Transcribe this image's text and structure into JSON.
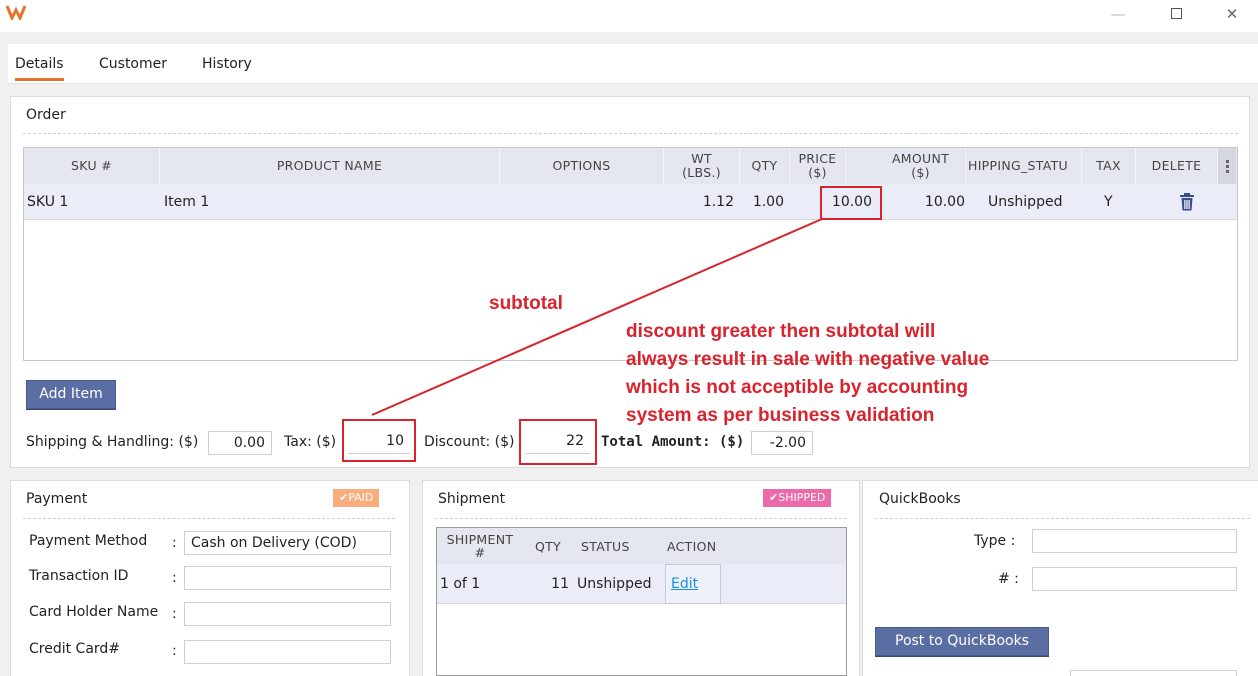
{
  "window": {
    "logo_icon": "app-logo-icon",
    "min_glyph": "—",
    "close_glyph": "✕"
  },
  "tabs": [
    {
      "label": "Details",
      "active": true
    },
    {
      "label": "Customer",
      "active": false
    },
    {
      "label": "History",
      "active": false
    }
  ],
  "order": {
    "title": "Order",
    "columns": [
      "SKU #",
      "PRODUCT NAME",
      "OPTIONS",
      "WT\n(LBS.)",
      "QTY",
      "PRICE\n($)",
      "AMOUNT\n($)",
      "HIPPING_STATU",
      "TAX",
      "DELETE"
    ],
    "rows": [
      {
        "sku": "SKU 1",
        "product": "Item 1",
        "options": "",
        "wt": "1.12",
        "qty": "1.00",
        "price": "10.00",
        "amount": "10.00",
        "shipping_status": "Unshipped",
        "tax": "Y",
        "delete_icon": "trash-icon"
      }
    ],
    "add_item_label": "Add Item",
    "shipping_label": "Shipping & Handling: ($)",
    "shipping_value": "0.00",
    "tax_label": "Tax: ($)",
    "tax_value": "10",
    "discount_label": "Discount: ($)",
    "discount_value": "22",
    "total_label": "Total Amount: ($)",
    "total_value": "-2.00"
  },
  "annotations": {
    "subtotal": "subtotal",
    "note_lines": [
      "discount greater then subtotal will",
      "always result in sale with negative value",
      "which is not acceptible by accounting",
      "system as per business validation"
    ],
    "color": "#d9232d"
  },
  "payment": {
    "title": "Payment",
    "badge": "PAID",
    "badge_color": "#f9ad7c",
    "fields": [
      {
        "label": "Payment Method",
        "value": "Cash on Delivery (COD)"
      },
      {
        "label": "Transaction ID",
        "value": ""
      },
      {
        "label": "Card Holder Name",
        "value": ""
      },
      {
        "label": "Credit Card#",
        "value": ""
      }
    ]
  },
  "shipment": {
    "title": "Shipment",
    "badge": "SHIPPED",
    "badge_color": "#ec6aa9",
    "columns": [
      "SHIPMENT\n#",
      "QTY",
      "STATUS",
      "ACTION"
    ],
    "rows": [
      {
        "shipment": "1 of 1",
        "qty": "11",
        "status": "Unshipped",
        "action": "Edit"
      }
    ]
  },
  "quickbooks": {
    "title": "QuickBooks",
    "type_label": "Type :",
    "number_label": "# :",
    "post_label": "Post to QuickBooks"
  },
  "colors": {
    "accent_tab": "#e8732b",
    "button_blue": "#5b6ea3",
    "grid_header": "#e4e7ef",
    "row_selected": "#eaedf8"
  }
}
